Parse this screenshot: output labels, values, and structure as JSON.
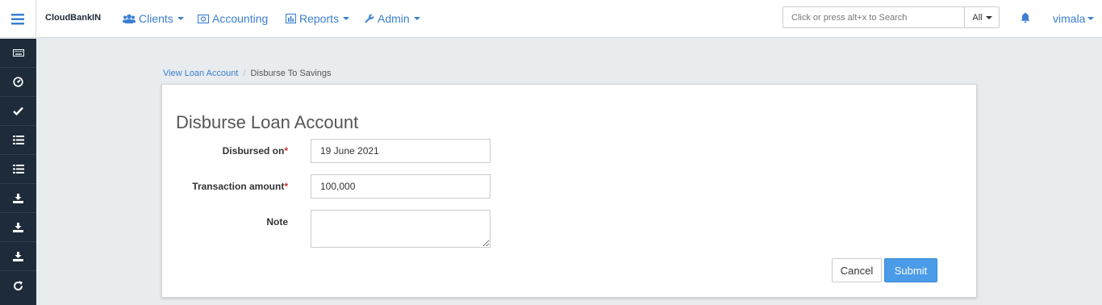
{
  "topbar": {
    "brand": "CloudBankIN",
    "nav": [
      {
        "label": "Clients",
        "icon": "users-icon",
        "dropdown": true
      },
      {
        "label": "Accounting",
        "icon": "money-icon",
        "dropdown": false
      },
      {
        "label": "Reports",
        "icon": "bar-chart-icon",
        "dropdown": true
      },
      {
        "label": "Admin",
        "icon": "wrench-icon",
        "dropdown": true
      }
    ],
    "search": {
      "placeholder": "Click or press alt+x to Search",
      "value": "",
      "scope": "All"
    },
    "user": "vimala"
  },
  "sidebar": {
    "items": [
      {
        "icon": "keyboard-icon"
      },
      {
        "icon": "dashboard-icon"
      },
      {
        "icon": "check-icon"
      },
      {
        "icon": "list-icon"
      },
      {
        "icon": "list-icon"
      },
      {
        "icon": "download-icon"
      },
      {
        "icon": "download-icon"
      },
      {
        "icon": "download-icon"
      },
      {
        "icon": "refresh-icon"
      }
    ]
  },
  "breadcrumb": {
    "link": "View Loan Account",
    "separator": "/",
    "current": "Disburse To Savings"
  },
  "form": {
    "title": "Disburse Loan Account",
    "disbursed_on": {
      "label": "Disbursed on",
      "required_mark": "*",
      "value": "19 June 2021"
    },
    "transaction_amount": {
      "label": "Transaction amount",
      "required_mark": "*",
      "value": "100,000"
    },
    "note": {
      "label": "Note",
      "value": ""
    },
    "cancel_label": "Cancel",
    "submit_label": "Submit"
  },
  "colors": {
    "accent": "#3a7fd0",
    "sidebar_bg": "#1d2b3a",
    "submit_bg": "#4a9be8",
    "required": "#c9302c",
    "page_bg": "#e9ecef"
  }
}
